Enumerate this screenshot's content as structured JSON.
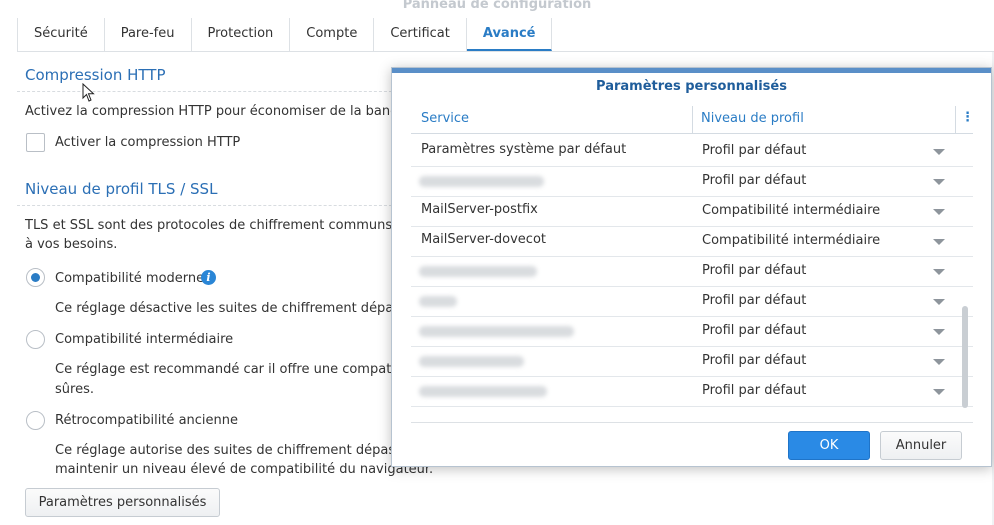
{
  "window": {
    "title": "Panneau de configuration"
  },
  "tabs": [
    {
      "label": "Sécurité"
    },
    {
      "label": "Pare-feu"
    },
    {
      "label": "Protection"
    },
    {
      "label": "Compte"
    },
    {
      "label": "Certificat"
    },
    {
      "label": "Avancé",
      "active": true
    }
  ],
  "http_compression": {
    "title": "Compression HTTP",
    "description": "Activez la compression HTTP pour économiser de la bande",
    "checkbox_label": "Activer la compression HTTP",
    "checked": false
  },
  "tls": {
    "title": "Niveau de profil TLS / SSL",
    "description_line1": "TLS et SSL sont des protocoles de chiffrement communs p",
    "description_line2": "à vos besoins.",
    "options": [
      {
        "label": "Compatibilité moderne",
        "checked": true,
        "desc_line1": "Ce réglage désactive les suites de chiffrement dépass",
        "desc_line2": ""
      },
      {
        "label": "Compatibilité intermédiaire",
        "checked": false,
        "desc_line1": "Ce réglage est recommandé car il offre une compatibi",
        "desc_line2": "sûres."
      },
      {
        "label": "Rétrocompatibilité ancienne",
        "checked": false,
        "desc_line1": "Ce réglage autorise des suites de chiffrement dépass",
        "desc_line2": "maintenir un niveau élevé de compatibilité du navigateur."
      }
    ],
    "custom_button": "Paramètres personnalisés"
  },
  "dialog": {
    "title": "Paramètres personnalisés",
    "columns": {
      "service": "Service",
      "level": "Niveau de profil"
    },
    "rows": [
      {
        "service": "Paramètres système par défaut",
        "level": "Profil par défaut",
        "blurred": false
      },
      {
        "service": "",
        "level": "Profil par défaut",
        "blurred": true
      },
      {
        "service": "MailServer-postfix",
        "level": "Compatibilité intermédiaire",
        "blurred": false
      },
      {
        "service": "MailServer-dovecot",
        "level": "Compatibilité intermédiaire",
        "blurred": false
      },
      {
        "service": "",
        "level": "Profil par défaut",
        "blurred": true
      },
      {
        "service": "",
        "level": "Profil par défaut",
        "blurred": true
      },
      {
        "service": "",
        "level": "Profil par défaut",
        "blurred": true
      },
      {
        "service": "",
        "level": "Profil par défaut",
        "blurred": true
      },
      {
        "service": "",
        "level": "Profil par défaut",
        "blurred": true
      }
    ],
    "ok": "OK",
    "cancel": "Annuler"
  },
  "icons": {
    "info": "info-icon",
    "menu": "column-menu-icon",
    "caret": "chevron-down-icon",
    "cursor": "mouse-pointer-icon"
  },
  "colors": {
    "accent": "#2a7cc5",
    "ok_button": "#2a8ae5"
  }
}
